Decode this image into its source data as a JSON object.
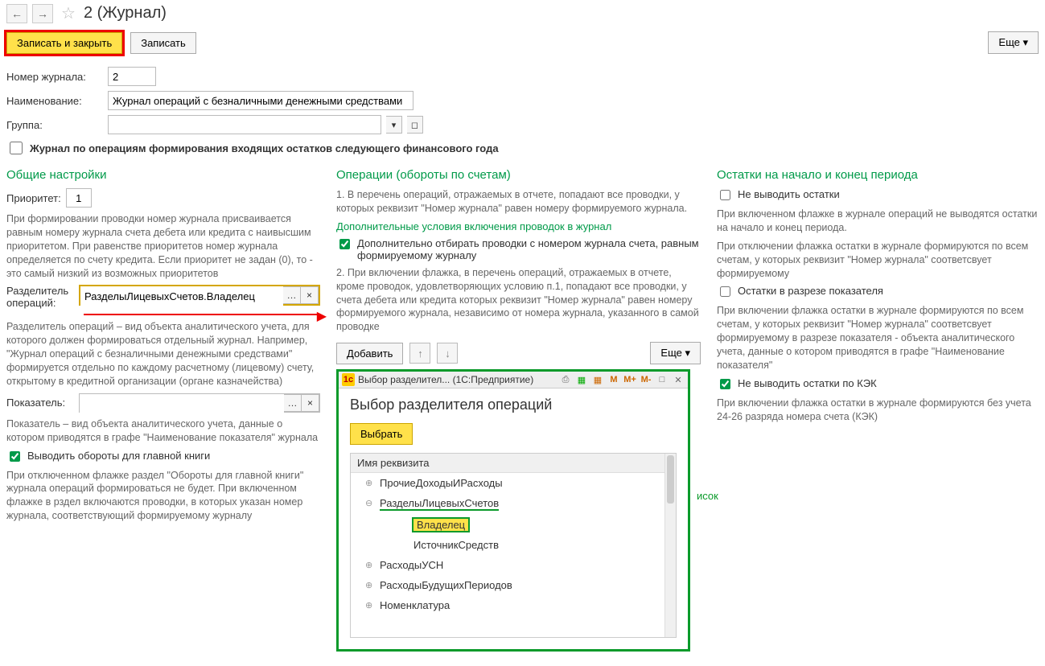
{
  "header": {
    "title": "2 (Журнал)"
  },
  "actions": {
    "save_close": "Записать и закрыть",
    "save": "Записать",
    "more": "Еще ▾"
  },
  "form": {
    "number_label": "Номер журнала:",
    "number_value": "2",
    "name_label": "Наименование:",
    "name_value": "Журнал операций с безналичными денежными средствами",
    "group_label": "Группа:",
    "group_value": "",
    "checkbox_incoming": "Журнал по операциям формирования входящих остатков следующего финансового года"
  },
  "left": {
    "head": "Общие настройки",
    "priority_label": "Приоритет:",
    "priority_value": "1",
    "priority_help": "При формировании проводки номер журнала присваивается равным номеру журнала счета дебета или кредита с наивысшим приоритетом. При равенстве приоритетов номер журнала определяется по счету кредита. Если приоритет не задан (0), то - это самый низкий из возможных приоритетов",
    "divider_label": "Разделитель операций:",
    "divider_value": "РазделыЛицевыхСчетов.Владелец",
    "divider_help": "Разделитель операций – вид объекта аналитического учета, для которого должен формироваться отдельный журнал. Например, \"Журнал операций с безналичными денежными средствами\" формируется отдельно по каждому расчетному (лицевому) счету, открытому в кредитной организации (органе казначейства)",
    "indicator_label": "Показатель:",
    "indicator_value": "",
    "indicator_help": "Показатель – вид объекта аналитического учета, данные о котором приводятся в графе \"Наименование показателя\" журнала",
    "gl_checkbox": "Выводить обороты для главной книги",
    "gl_help": "При отключенном флажке раздел \"Обороты для главной книги\" журнала операций формироваться не будет. При включенном флажке в рздел включаются проводки, в которых указан номер журнала, соответствующий формируемому журналу"
  },
  "mid": {
    "head": "Операции (обороты по счетам)",
    "p1": "1. В перечень операций, отражаемых в отчете, попадают все проводки, у которых реквизит \"Номер журнала\" равен номеру формируемого журнала.",
    "subhead": "Дополнительные условия включения проводок в журнал",
    "cb_extra": "Дополнительно отбирать проводки с номером журнала счета, равным формируемому журналу",
    "p2": "2. При включении флажка, в перечень операций, отражаемых в отчете, кроме проводок, удовлетворяющих условию п.1, попадают все проводки, у счета дебета или кредита которых реквизит \"Номер журнала\" равен номеру формируемого журнала, независимо от номера журнала, указанного в самой проводке",
    "add": "Добавить",
    "more": "Еще ▾",
    "side_text": "исок"
  },
  "right": {
    "head": "Остатки на начало и конец периода",
    "cb1": "Не выводить остатки",
    "p1": "При включенном флажке в журнале операций не выводятся остатки на начало и конец периода.",
    "p2": "При отключении флажка остатки в журнале формируются по всем счетам, у которых реквизит \"Номер журнала\" соответсвует формируемому",
    "cb2": "Остатки в разрезе показателя",
    "p3": "При включении флажка остатки в журнале формируются по всем счетам, у которых реквизит \"Номер журнала\" соответсвует формируемому в разрезе показателя - объекта аналитического учета, данные о котором приводятся в графе \"Наименование показателя\"",
    "cb3": "Не выводить остатки по КЭК",
    "p4": "При включении флажка остатки в журнале формируются без учета 24-26 разряда номера счета (КЭК)"
  },
  "dialog": {
    "title": "Выбор разделител... (1С:Предприятие)",
    "head": "Выбор разделителя операций",
    "select": "Выбрать",
    "col_header": "Имя реквизита",
    "items": {
      "i1": "ПрочиеДоходыИРасходы",
      "i2": "РазделыЛицевыхСчетов",
      "i2a": "Владелец",
      "i2b": "ИсточникСредств",
      "i3": "РасходыУСН",
      "i4": "РасходыБудущихПериодов",
      "i5": "Номенклатура"
    },
    "toolbar": {
      "m": "M",
      "mp": "M+",
      "mm": "M-"
    }
  }
}
